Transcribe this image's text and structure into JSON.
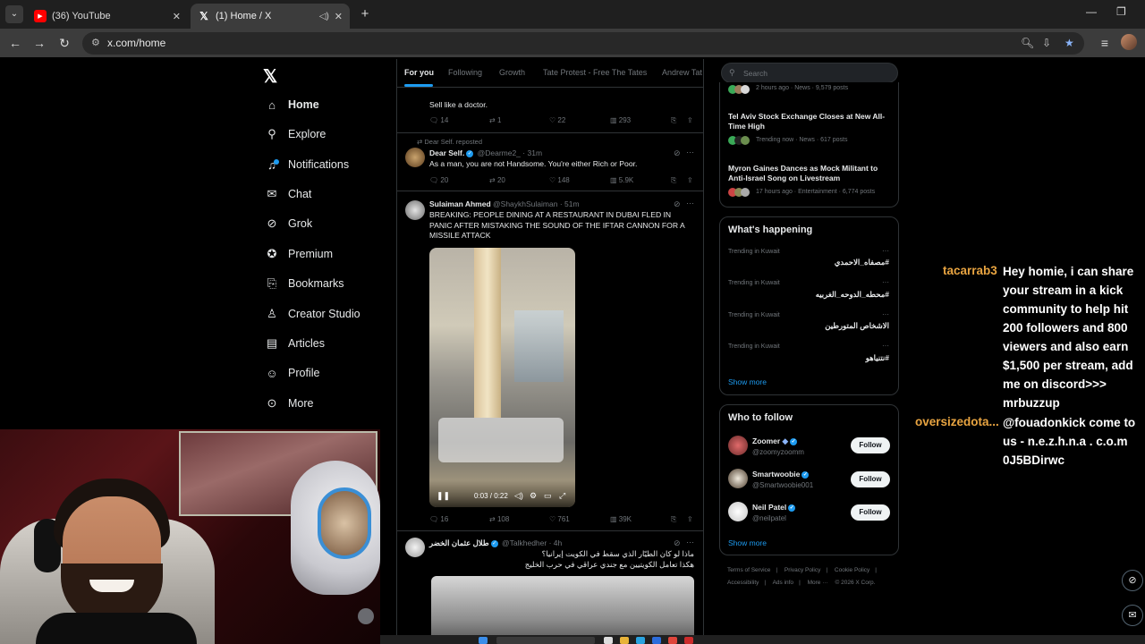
{
  "browser": {
    "tabs": [
      {
        "title": "(36) YouTube",
        "favicon": "youtube-icon",
        "active": false
      },
      {
        "title": "(1) Home / X",
        "favicon": "x-icon",
        "active": true
      }
    ],
    "url": "x.com/home"
  },
  "sidebar": {
    "items": [
      {
        "label": "Home",
        "icon": "home-icon"
      },
      {
        "label": "Explore",
        "icon": "search-icon"
      },
      {
        "label": "Notifications",
        "icon": "bell-icon"
      },
      {
        "label": "Chat",
        "icon": "mail-icon"
      },
      {
        "label": "Grok",
        "icon": "grok-icon"
      },
      {
        "label": "Premium",
        "icon": "premium-icon"
      },
      {
        "label": "Bookmarks",
        "icon": "bookmark-icon"
      },
      {
        "label": "Creator Studio",
        "icon": "creator-icon"
      },
      {
        "label": "Articles",
        "icon": "articles-icon"
      },
      {
        "label": "Profile",
        "icon": "profile-icon"
      },
      {
        "label": "More",
        "icon": "more-icon"
      }
    ]
  },
  "timeline": {
    "tabs": [
      "For you",
      "Following",
      "Growth",
      "Tate Protest - Free The Tates",
      "Andrew Tat"
    ],
    "posts": [
      {
        "text": "Sell like a doctor.",
        "replies": "14",
        "reposts": "1",
        "likes": "22",
        "views": "293"
      },
      {
        "reposted_by": "Dear Self. reposted",
        "name": "Dear Self.",
        "handle": "@Dearme2_",
        "time": "· 31m",
        "text": "As a man, you are not Handsome. You're either Rich or Poor.",
        "replies": "20",
        "reposts": "20",
        "likes": "148",
        "views": "5.9K"
      },
      {
        "name": "Sulaiman Ahmed",
        "handle": "@ShaykhSulaiman",
        "time": "· 51m",
        "text": "BREAKING: PEOPLE DINING AT A RESTAURANT IN DUBAI FLED IN PANIC AFTER MISTAKING THE SOUND OF THE IFTAR CANNON FOR A MISSILE ATTACK",
        "video_time": "0:03 / 0:22",
        "replies": "16",
        "reposts": "108",
        "likes": "761",
        "views": "39K"
      },
      {
        "name": "طلال عثمان الخضر",
        "handle": "@Talkhedher",
        "time": "· 4h",
        "text_line1": "ماذا لو كان الطيّار الذي سقط في الكويت إيرانيا؟",
        "text_line2": "هكذا تعامل الكويتيين مع جندي عراقي في حرب الخليج"
      }
    ]
  },
  "right": {
    "search_placeholder": "Search",
    "news": [
      {
        "meta": "2 hours ago · News · 9,579 posts"
      },
      {
        "title": "Tel Aviv Stock Exchange Closes at New All-Time High",
        "meta": "Trending now · News · 617 posts"
      },
      {
        "title": "Myron Gaines Dances as Mock Militant to Anti-Israel Song on Livestream",
        "meta": "17 hours ago · Entertainment · 6,774 posts"
      }
    ],
    "whats_happening": {
      "title": "What's happening",
      "trends": [
        {
          "category": "Trending in Kuwait",
          "name": "#مصفاه_الاحمدي"
        },
        {
          "category": "Trending in Kuwait",
          "name": "#محطه_الدوحه_الغربيه"
        },
        {
          "category": "Trending in Kuwait",
          "name": "الاشخاص المتورطين"
        },
        {
          "category": "Trending in Kuwait",
          "name": "#نتنياهو"
        }
      ],
      "show_more": "Show more"
    },
    "who_to_follow": {
      "title": "Who to follow",
      "accounts": [
        {
          "name": "Zoomer",
          "handle": "@zoomyzoomm",
          "button": "Follow"
        },
        {
          "name": "Smartwoobie",
          "handle": "@Smartwoobie001",
          "button": "Follow"
        },
        {
          "name": "Neil Patel",
          "handle": "@neilpatel",
          "button": "Follow"
        }
      ],
      "show_more": "Show more"
    },
    "footer": [
      "Terms of Service",
      "|",
      "Privacy Policy",
      "|",
      "Cookie Policy",
      "|",
      "Accessibility",
      "|",
      "Ads info",
      "|",
      "More ···",
      "© 2026 X Corp."
    ]
  },
  "chat": [
    {
      "user": "tacarrab3",
      "message": "Hey homie, i can share your stream in a kick community to help hit 200 followers and 800 viewers and also earn $1,500 per stream, add me on discord>>> mrbuzzup"
    },
    {
      "user": "oversizedota...",
      "message": "@fouadonkick come to us - n.e.z.h.n.a . c.o.m 0J5BDirwc"
    }
  ],
  "colors": {
    "accent": "#1d9bf0",
    "chat_user": "#e8a441"
  }
}
